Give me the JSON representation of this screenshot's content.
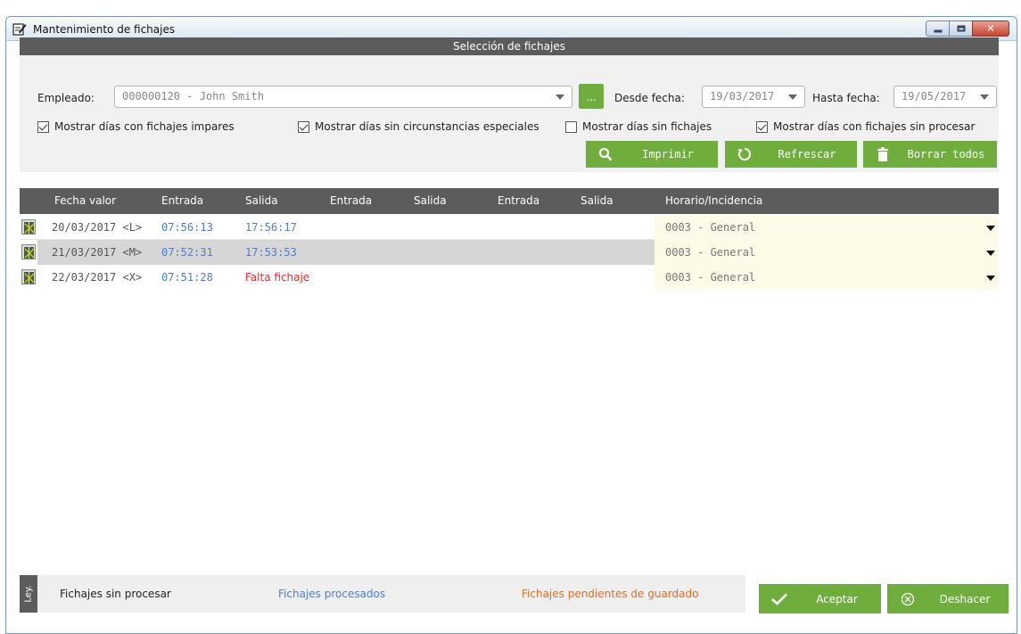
{
  "window": {
    "title": "Mantenimiento de fichajes"
  },
  "selection": {
    "header": "Selección de fichajes",
    "empleado_label": "Empleado:",
    "empleado_value": "000000120 - John Smith",
    "dots_label": "...",
    "desde_label": "Desde fecha:",
    "desde_value": "19/03/2017",
    "hasta_label": "Hasta fecha:",
    "hasta_value": "19/05/2017",
    "checks": [
      {
        "label": "Mostrar días con fichajes impares",
        "checked": true
      },
      {
        "label": "Mostrar días sin circunstancias especiales",
        "checked": true
      },
      {
        "label": "Mostrar días sin fichajes",
        "checked": false
      },
      {
        "label": "Mostrar días con fichajes sin procesar",
        "checked": true
      }
    ],
    "buttons": {
      "imprimir": "Imprimir",
      "refrescar": "Refrescar",
      "borrar": "Borrar todos"
    }
  },
  "grid": {
    "columns": [
      "Fecha valor",
      "Entrada",
      "Salida",
      "Entrada",
      "Salida",
      "Entrada",
      "Salida",
      "Horario/Incidencia"
    ],
    "rows": [
      {
        "fecha": "20/03/2017 <L>",
        "entrada1": "07:56:13",
        "salida1": "17:56:17",
        "horario": "0003 - General",
        "highlight": false
      },
      {
        "fecha": "21/03/2017 <M>",
        "entrada1": "07:52:31",
        "salida1": "17:53:53",
        "horario": "0003 - General",
        "highlight": true
      },
      {
        "fecha": "22/03/2017 <X>",
        "entrada1": "07:51:28",
        "salida1": "Falta fichaje",
        "horario": "0003 - General",
        "highlight": false
      }
    ]
  },
  "legend": {
    "tag": "Ley.",
    "sin_procesar": "Fichajes sin procesar",
    "procesados": "Fichajes procesados",
    "pendientes": "Fichajes pendientes de guardado"
  },
  "footer": {
    "aceptar": "Aceptar",
    "deshacer": "Deshacer"
  },
  "colors": {
    "accent_green": "#6fae3d",
    "header_gray": "#5c5c5c",
    "processed_blue": "#4a7fd0",
    "missing_red": "#e03030",
    "pending_orange": "#d9702a",
    "unprocessed_text": "#555555"
  },
  "icons": {
    "title": "notepad-pencil-icon",
    "search": "search-icon",
    "refresh": "refresh-icon",
    "trash": "trash-icon",
    "check": "check-icon",
    "cancel": "circle-x-icon",
    "row": "book-icon"
  }
}
